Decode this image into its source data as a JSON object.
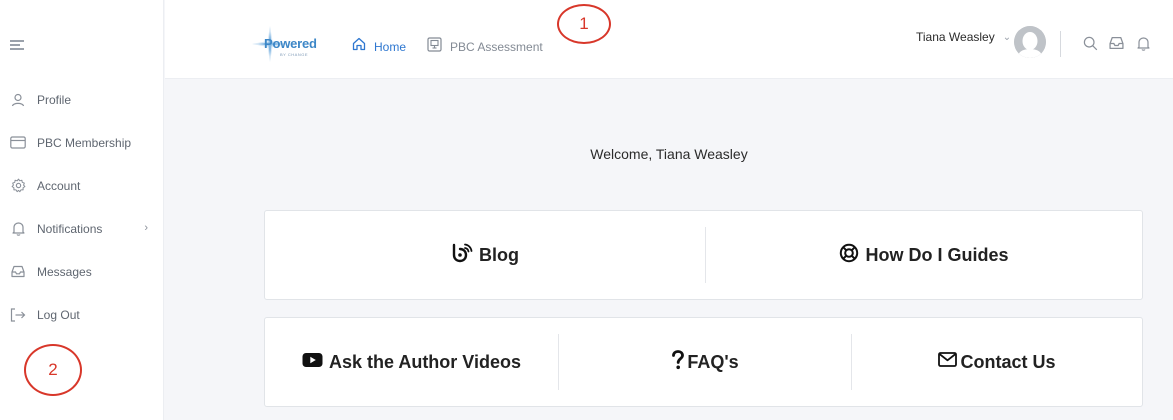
{
  "sidebar": {
    "items": [
      {
        "label": "Profile",
        "icon": "user-icon"
      },
      {
        "label": "PBC Membership",
        "icon": "credit-card-icon"
      },
      {
        "label": "Account",
        "icon": "gear-icon"
      },
      {
        "label": "Notifications",
        "icon": "bell-icon",
        "chevron": "›"
      },
      {
        "label": "Messages",
        "icon": "inbox-icon"
      },
      {
        "label": "Log Out",
        "icon": "logout-icon"
      }
    ]
  },
  "header": {
    "logo_text": "Powered",
    "logo_sub": "BY CHANGE",
    "nav": [
      {
        "label": "Home",
        "icon": "home-icon",
        "active": true
      },
      {
        "label": "PBC Assessment",
        "icon": "assessment-icon",
        "active": false
      }
    ],
    "user_name": "Tiana Weasley",
    "caret": "⌄"
  },
  "main": {
    "welcome": "Welcome, Tiana Weasley",
    "cards_row1": [
      {
        "label": "Blog",
        "icon": "blog-feed-icon"
      },
      {
        "label": "How Do I Guides",
        "icon": "lifebuoy-icon"
      }
    ],
    "cards_row2": [
      {
        "label": "Ask the Author Videos",
        "icon": "youtube-icon"
      },
      {
        "label": "FAQ's",
        "icon": "question-icon"
      },
      {
        "label": "Contact Us",
        "icon": "envelope-icon"
      }
    ]
  },
  "annotations": [
    "1",
    "2"
  ],
  "colors": {
    "accent": "#2e77d0",
    "annotation": "#d8372a",
    "sidebar_text": "#5f6670"
  }
}
